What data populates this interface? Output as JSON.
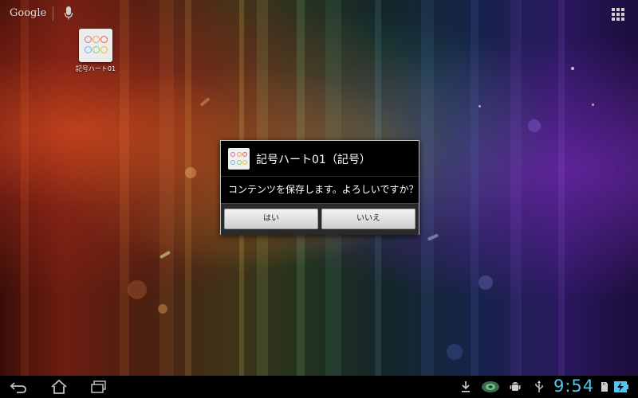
{
  "top_bar": {
    "search_label": "Google",
    "icons": {
      "mic": "microphone-icon",
      "apps": "apps-grid-icon"
    }
  },
  "desktop": {
    "shortcut": {
      "label": "記号ハート01",
      "icon": "heart-symbols-icon"
    }
  },
  "dialog": {
    "title": "記号ハート01（記号）",
    "message": "コンテンツを保存します。よろしいですか？",
    "buttons": {
      "yes": "はい",
      "no": "いいえ"
    }
  },
  "system_bar": {
    "clock": "9:54",
    "nav_icons": [
      "back-icon",
      "home-icon",
      "recent-apps-icon"
    ],
    "status_icons": [
      "download-icon",
      "sync-icon",
      "android-debug-icon",
      "usb-icon",
      "sd-card-icon",
      "battery-charging-icon"
    ],
    "clock_color": "#52c6ee"
  },
  "colors": {
    "dialog_background": "#000000",
    "button_background": "#e6e6e6",
    "status_accent": "#52c6ee"
  }
}
